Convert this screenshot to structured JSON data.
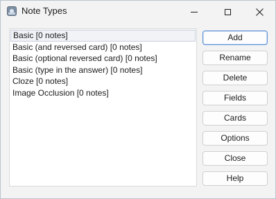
{
  "window": {
    "title": "Note Types",
    "icon": "anki-app-icon",
    "controls": {
      "minimize": "minimize-icon",
      "maximize": "maximize-icon",
      "close": "close-icon"
    }
  },
  "note_types": [
    {
      "label": "Basic [0 notes]",
      "selected": true
    },
    {
      "label": "Basic (and reversed card) [0 notes]",
      "selected": false
    },
    {
      "label": "Basic (optional reversed card) [0 notes]",
      "selected": false
    },
    {
      "label": "Basic (type in the answer) [0 notes]",
      "selected": false
    },
    {
      "label": "Cloze [0 notes]",
      "selected": false
    },
    {
      "label": "Image Occlusion [0 notes]",
      "selected": false
    }
  ],
  "buttons": {
    "add": "Add",
    "rename": "Rename",
    "delete": "Delete",
    "fields": "Fields",
    "cards": "Cards",
    "options": "Options",
    "close": "Close",
    "help": "Help"
  },
  "colors": {
    "window_bg": "#f3f3f3",
    "list_bg": "#ffffff",
    "selection_bg": "#f1f3f7",
    "default_button_border": "#5b8fd6"
  }
}
